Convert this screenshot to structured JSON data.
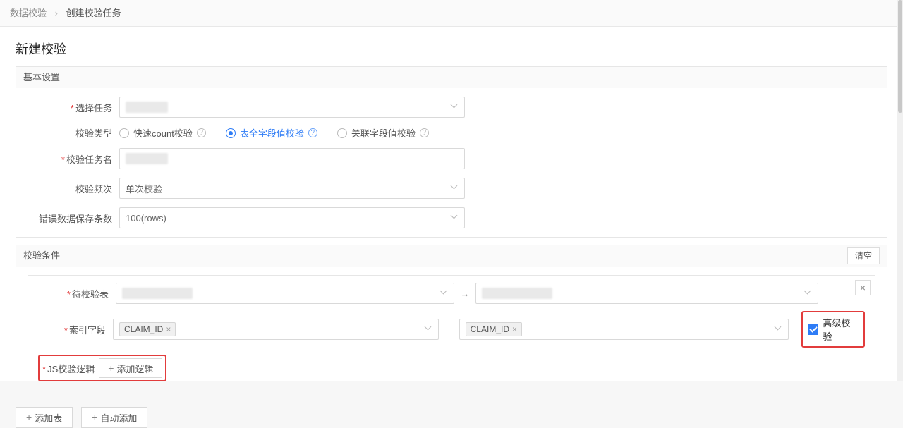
{
  "breadcrumb": {
    "root": "数据校验",
    "current": "创建校验任务"
  },
  "page_title": "新建校验",
  "basic": {
    "panel_title": "基本设置",
    "labels": {
      "select_task": "选择任务",
      "check_type": "校验类型",
      "task_name": "校验任务名",
      "frequency": "校验频次",
      "save_rows": "错误数据保存条数"
    },
    "radios": {
      "opt1": "快速count校验",
      "opt2": "表全字段值校验",
      "opt3": "关联字段值校验"
    },
    "frequency_value": "单次校验",
    "save_rows_value": "100(rows)"
  },
  "cond": {
    "panel_title": "校验条件",
    "clear_label": "清空",
    "labels": {
      "table": "待校验表",
      "index": "索引字段",
      "js_logic": "JS校验逻辑"
    },
    "index_tag": "CLAIM_ID",
    "add_logic": "添加逻辑",
    "advanced_check": "高级校验"
  },
  "bottom": {
    "add_table": "添加表",
    "auto_add": "自动添加"
  }
}
